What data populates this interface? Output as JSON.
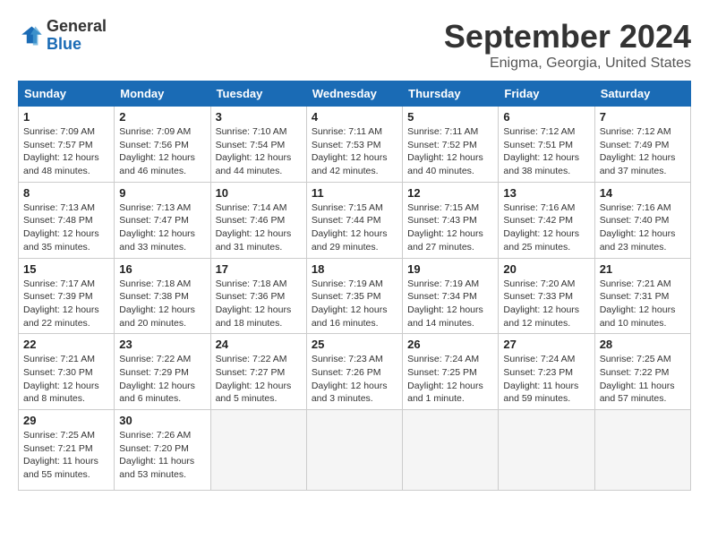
{
  "logo": {
    "line1": "General",
    "line2": "Blue"
  },
  "title": "September 2024",
  "location": "Enigma, Georgia, United States",
  "days_of_week": [
    "Sunday",
    "Monday",
    "Tuesday",
    "Wednesday",
    "Thursday",
    "Friday",
    "Saturday"
  ],
  "weeks": [
    [
      {
        "day": 1,
        "info": "Sunrise: 7:09 AM\nSunset: 7:57 PM\nDaylight: 12 hours\nand 48 minutes."
      },
      {
        "day": 2,
        "info": "Sunrise: 7:09 AM\nSunset: 7:56 PM\nDaylight: 12 hours\nand 46 minutes."
      },
      {
        "day": 3,
        "info": "Sunrise: 7:10 AM\nSunset: 7:54 PM\nDaylight: 12 hours\nand 44 minutes."
      },
      {
        "day": 4,
        "info": "Sunrise: 7:11 AM\nSunset: 7:53 PM\nDaylight: 12 hours\nand 42 minutes."
      },
      {
        "day": 5,
        "info": "Sunrise: 7:11 AM\nSunset: 7:52 PM\nDaylight: 12 hours\nand 40 minutes."
      },
      {
        "day": 6,
        "info": "Sunrise: 7:12 AM\nSunset: 7:51 PM\nDaylight: 12 hours\nand 38 minutes."
      },
      {
        "day": 7,
        "info": "Sunrise: 7:12 AM\nSunset: 7:49 PM\nDaylight: 12 hours\nand 37 minutes."
      }
    ],
    [
      {
        "day": 8,
        "info": "Sunrise: 7:13 AM\nSunset: 7:48 PM\nDaylight: 12 hours\nand 35 minutes."
      },
      {
        "day": 9,
        "info": "Sunrise: 7:13 AM\nSunset: 7:47 PM\nDaylight: 12 hours\nand 33 minutes."
      },
      {
        "day": 10,
        "info": "Sunrise: 7:14 AM\nSunset: 7:46 PM\nDaylight: 12 hours\nand 31 minutes."
      },
      {
        "day": 11,
        "info": "Sunrise: 7:15 AM\nSunset: 7:44 PM\nDaylight: 12 hours\nand 29 minutes."
      },
      {
        "day": 12,
        "info": "Sunrise: 7:15 AM\nSunset: 7:43 PM\nDaylight: 12 hours\nand 27 minutes."
      },
      {
        "day": 13,
        "info": "Sunrise: 7:16 AM\nSunset: 7:42 PM\nDaylight: 12 hours\nand 25 minutes."
      },
      {
        "day": 14,
        "info": "Sunrise: 7:16 AM\nSunset: 7:40 PM\nDaylight: 12 hours\nand 23 minutes."
      }
    ],
    [
      {
        "day": 15,
        "info": "Sunrise: 7:17 AM\nSunset: 7:39 PM\nDaylight: 12 hours\nand 22 minutes."
      },
      {
        "day": 16,
        "info": "Sunrise: 7:18 AM\nSunset: 7:38 PM\nDaylight: 12 hours\nand 20 minutes."
      },
      {
        "day": 17,
        "info": "Sunrise: 7:18 AM\nSunset: 7:36 PM\nDaylight: 12 hours\nand 18 minutes."
      },
      {
        "day": 18,
        "info": "Sunrise: 7:19 AM\nSunset: 7:35 PM\nDaylight: 12 hours\nand 16 minutes."
      },
      {
        "day": 19,
        "info": "Sunrise: 7:19 AM\nSunset: 7:34 PM\nDaylight: 12 hours\nand 14 minutes."
      },
      {
        "day": 20,
        "info": "Sunrise: 7:20 AM\nSunset: 7:33 PM\nDaylight: 12 hours\nand 12 minutes."
      },
      {
        "day": 21,
        "info": "Sunrise: 7:21 AM\nSunset: 7:31 PM\nDaylight: 12 hours\nand 10 minutes."
      }
    ],
    [
      {
        "day": 22,
        "info": "Sunrise: 7:21 AM\nSunset: 7:30 PM\nDaylight: 12 hours\nand 8 minutes."
      },
      {
        "day": 23,
        "info": "Sunrise: 7:22 AM\nSunset: 7:29 PM\nDaylight: 12 hours\nand 6 minutes."
      },
      {
        "day": 24,
        "info": "Sunrise: 7:22 AM\nSunset: 7:27 PM\nDaylight: 12 hours\nand 5 minutes."
      },
      {
        "day": 25,
        "info": "Sunrise: 7:23 AM\nSunset: 7:26 PM\nDaylight: 12 hours\nand 3 minutes."
      },
      {
        "day": 26,
        "info": "Sunrise: 7:24 AM\nSunset: 7:25 PM\nDaylight: 12 hours\nand 1 minute."
      },
      {
        "day": 27,
        "info": "Sunrise: 7:24 AM\nSunset: 7:23 PM\nDaylight: 11 hours\nand 59 minutes."
      },
      {
        "day": 28,
        "info": "Sunrise: 7:25 AM\nSunset: 7:22 PM\nDaylight: 11 hours\nand 57 minutes."
      }
    ],
    [
      {
        "day": 29,
        "info": "Sunrise: 7:25 AM\nSunset: 7:21 PM\nDaylight: 11 hours\nand 55 minutes."
      },
      {
        "day": 30,
        "info": "Sunrise: 7:26 AM\nSunset: 7:20 PM\nDaylight: 11 hours\nand 53 minutes."
      },
      null,
      null,
      null,
      null,
      null
    ]
  ]
}
